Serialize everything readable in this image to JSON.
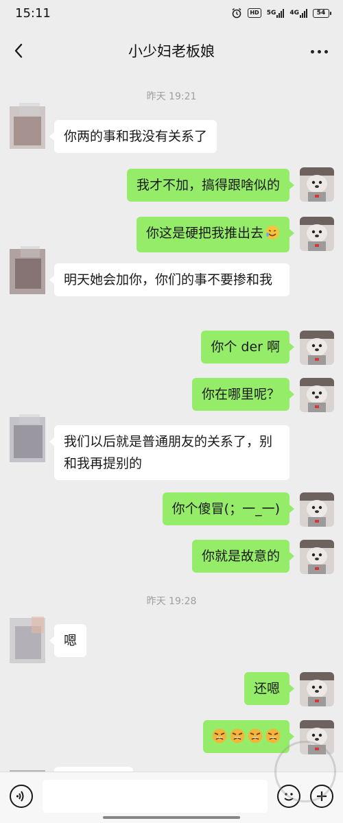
{
  "status_bar": {
    "time": "15:11",
    "hd_label": "HD",
    "network_1": "5G",
    "network_2": "4G",
    "battery": "54"
  },
  "header": {
    "title": "小少妇老板娘",
    "back_icon": "chevron-left-icon",
    "more_icon": "more-dots-icon"
  },
  "messages": {
    "ts1": "昨天 19:21",
    "m1": "你两的事和我没有关系了",
    "m2": "我才不加，搞得跟啥似的",
    "m3": "你这是硬把我推出去",
    "m4": "明天她会加你，你们的事不要掺和我",
    "m5": "你个 der 啊",
    "m6": "你在哪里呢？",
    "m7": "我们以后就是普通朋友的关系了，别和我再提别的",
    "m8": "你个傻冒(；一_一)",
    "m9": "你就是故意的",
    "ts2": "昨天 19:28",
    "m10": "嗯",
    "m11": "还嗯",
    "m12_emoji": "angry-face-emoji x4"
  },
  "input_bar": {
    "voice_icon": "voice-icon",
    "emoji_icon": "emoji-icon",
    "plus_icon": "plus-icon"
  },
  "colors": {
    "background": "#EDEDED",
    "sent_bubble": "#95EC69",
    "received_bubble": "#FFFFFF",
    "timestamp": "#9E9E9E"
  }
}
